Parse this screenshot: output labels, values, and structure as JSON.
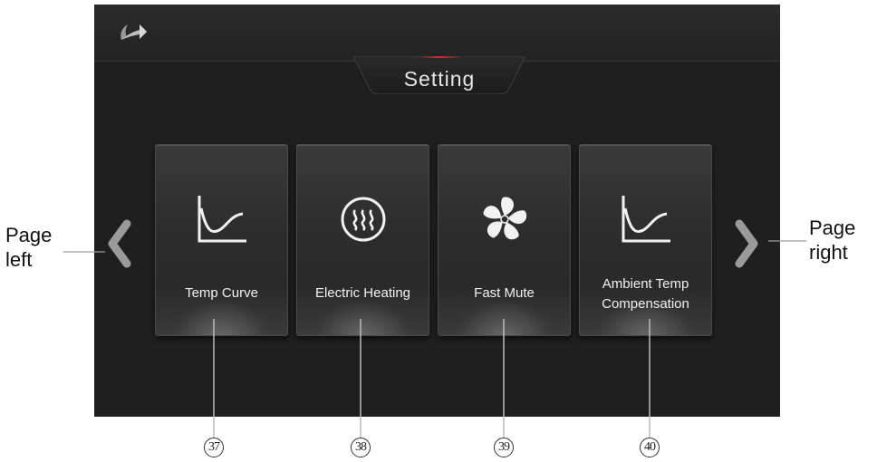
{
  "screen": {
    "title": "Setting"
  },
  "navigation": {
    "back": "back",
    "page_left_label_line1": "Page",
    "page_left_label_line2": "left",
    "page_right_label_line1": "Page",
    "page_right_label_line2": "right"
  },
  "cards": [
    {
      "label": "Temp Curve",
      "icon": "curve-chart-icon",
      "callout": "37"
    },
    {
      "label": "Electric Heating",
      "icon": "heating-icon",
      "callout": "38"
    },
    {
      "label": "Fast Mute",
      "icon": "fan-icon",
      "callout": "39"
    },
    {
      "label_line1": "Ambient Temp",
      "label_line2": "Compensation",
      "icon": "curve-chart-icon",
      "callout": "40"
    }
  ],
  "colors": {
    "screen_bg": "#1f1f1f",
    "accent_red": "#e0252a",
    "text": "#f2f2f2"
  }
}
